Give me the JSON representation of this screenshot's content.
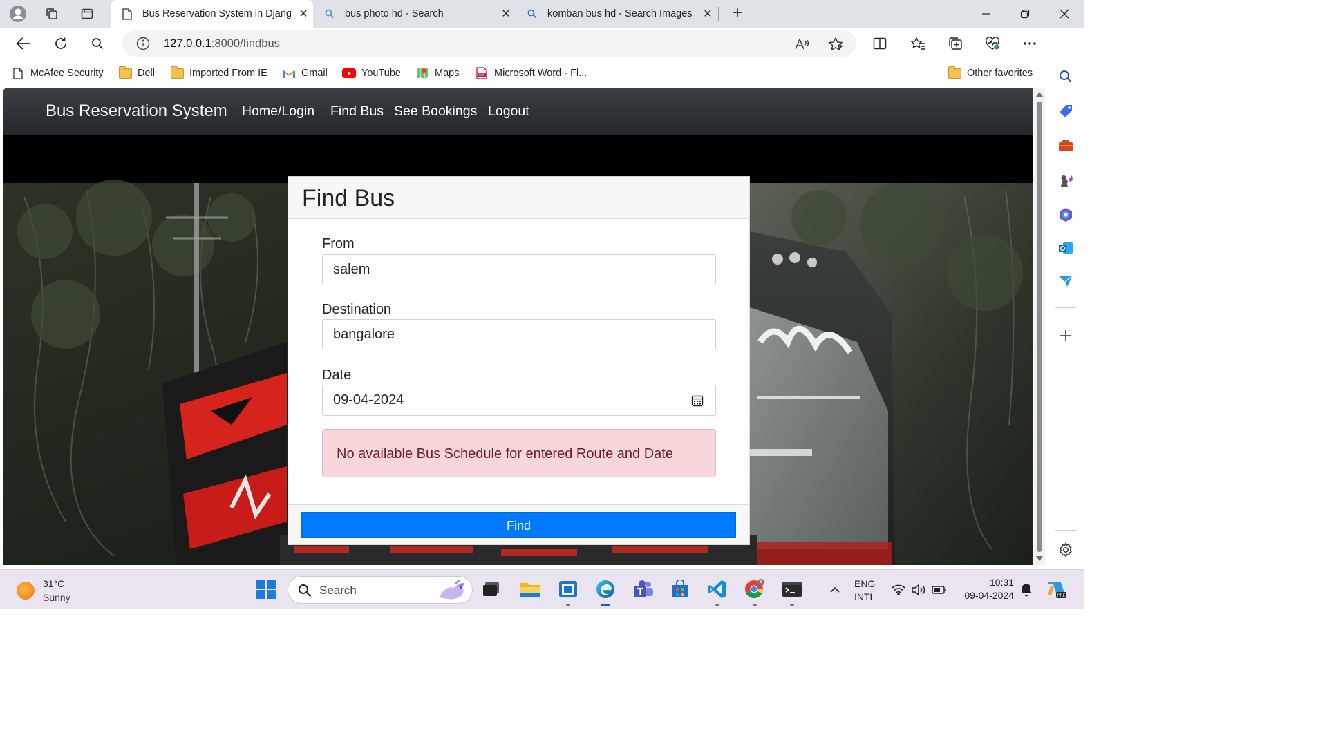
{
  "browser": {
    "tabs": [
      {
        "title": "Bus Reservation System in Djang",
        "active": true
      },
      {
        "title": "bus photo hd - Search",
        "active": false
      },
      {
        "title": "komban bus hd - Search Images",
        "active": false
      }
    ],
    "url_host": "127.0.0.1",
    "url_path": ":8000/findbus",
    "favorites": [
      {
        "label": "McAfee Security",
        "icon": "page-icon"
      },
      {
        "label": "Dell",
        "icon": "folder-icon"
      },
      {
        "label": "Imported From IE",
        "icon": "folder-icon"
      },
      {
        "label": "Gmail",
        "icon": "gmail-icon"
      },
      {
        "label": "YouTube",
        "icon": "youtube-icon"
      },
      {
        "label": "Maps",
        "icon": "maps-icon"
      },
      {
        "label": "Microsoft Word - Fl...",
        "icon": "pdf-icon"
      }
    ],
    "other_favorites": "Other favorites"
  },
  "site": {
    "brand": "Bus Reservation System",
    "nav": [
      "Home/Login",
      "Find Bus",
      "See Bookings",
      "Logout"
    ]
  },
  "form": {
    "title": "Find Bus",
    "from_label": "From",
    "from_value": "salem",
    "destination_label": "Destination",
    "destination_value": "bangalore",
    "date_label": "Date",
    "date_value": "09-04-2024",
    "alert": "No available Bus Schedule for entered Route and Date",
    "submit_label": "Find"
  },
  "taskbar": {
    "temperature": "31°C",
    "condition": "Sunny",
    "search_placeholder": "Search",
    "lang_line1": "ENG",
    "lang_line2": "INTL",
    "time": "10:31",
    "date": "09-04-2024"
  },
  "colors": {
    "primary": "#007bff",
    "alert_bg": "#f8d7da",
    "alert_text": "#721c24",
    "navbar": "#343a40"
  }
}
